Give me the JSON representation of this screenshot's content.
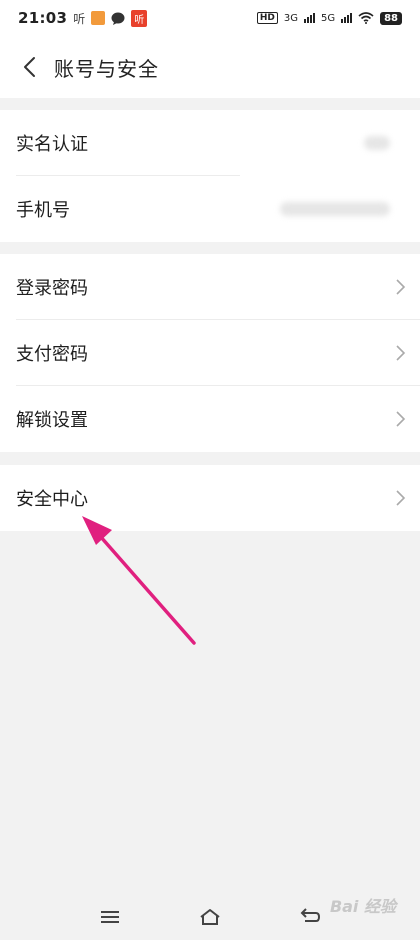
{
  "status_bar": {
    "time": "21:03",
    "app_label_1": "听",
    "app_label_2": "听",
    "hd": "HD",
    "net_1": "3G",
    "net_2": "5G",
    "battery": "88"
  },
  "header": {
    "title": "账号与安全"
  },
  "groups": {
    "identity": {
      "real_name": "实名认证",
      "phone": "手机号"
    },
    "passwords": {
      "login_password": "登录密码",
      "pay_password": "支付密码",
      "unlock_settings": "解锁设置"
    },
    "security": {
      "security_center": "安全中心"
    }
  },
  "watermark": "Bai 经验",
  "colors": {
    "accent_arrow": "#e0207f",
    "background": "#f2f2f2",
    "card": "#ffffff"
  }
}
